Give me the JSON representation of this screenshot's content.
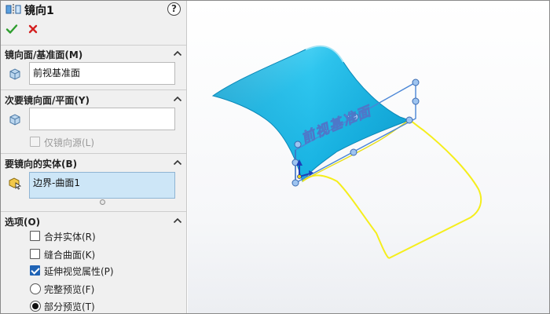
{
  "panel": {
    "title": "镜向1",
    "help_symbol": "?",
    "mirror_face": {
      "label": "镜向面/基准面(M)",
      "value": "前视基准面"
    },
    "secondary_face": {
      "label": "次要镜向面/平面(Y)",
      "value": "",
      "mirror_source_label": "仅镜向源(L)",
      "mirror_source_checked": false
    },
    "bodies": {
      "label": "要镜向的实体(B)",
      "value": "边界-曲面1"
    },
    "options": {
      "label": "选项(O)",
      "merge_solids": {
        "label": "合并实体(R)",
        "checked": false
      },
      "knit_surfaces": {
        "label": "缝合曲面(K)",
        "checked": false
      },
      "propagate_visual": {
        "label": "延伸视觉属性(P)",
        "checked": true
      },
      "full_preview": {
        "label": "完整预览(F)",
        "selected": false
      },
      "partial_preview": {
        "label": "部分预览(T)",
        "selected": true
      }
    }
  },
  "viewport": {
    "plane_label": "前视基准面",
    "surface_color": "#29c4ee",
    "preview_color": "#f5ee1c",
    "plane_color": "#4a86d6"
  },
  "colors": {
    "ok": "#2e9e2e",
    "cancel": "#d42020",
    "accent": "#1f63b5"
  }
}
